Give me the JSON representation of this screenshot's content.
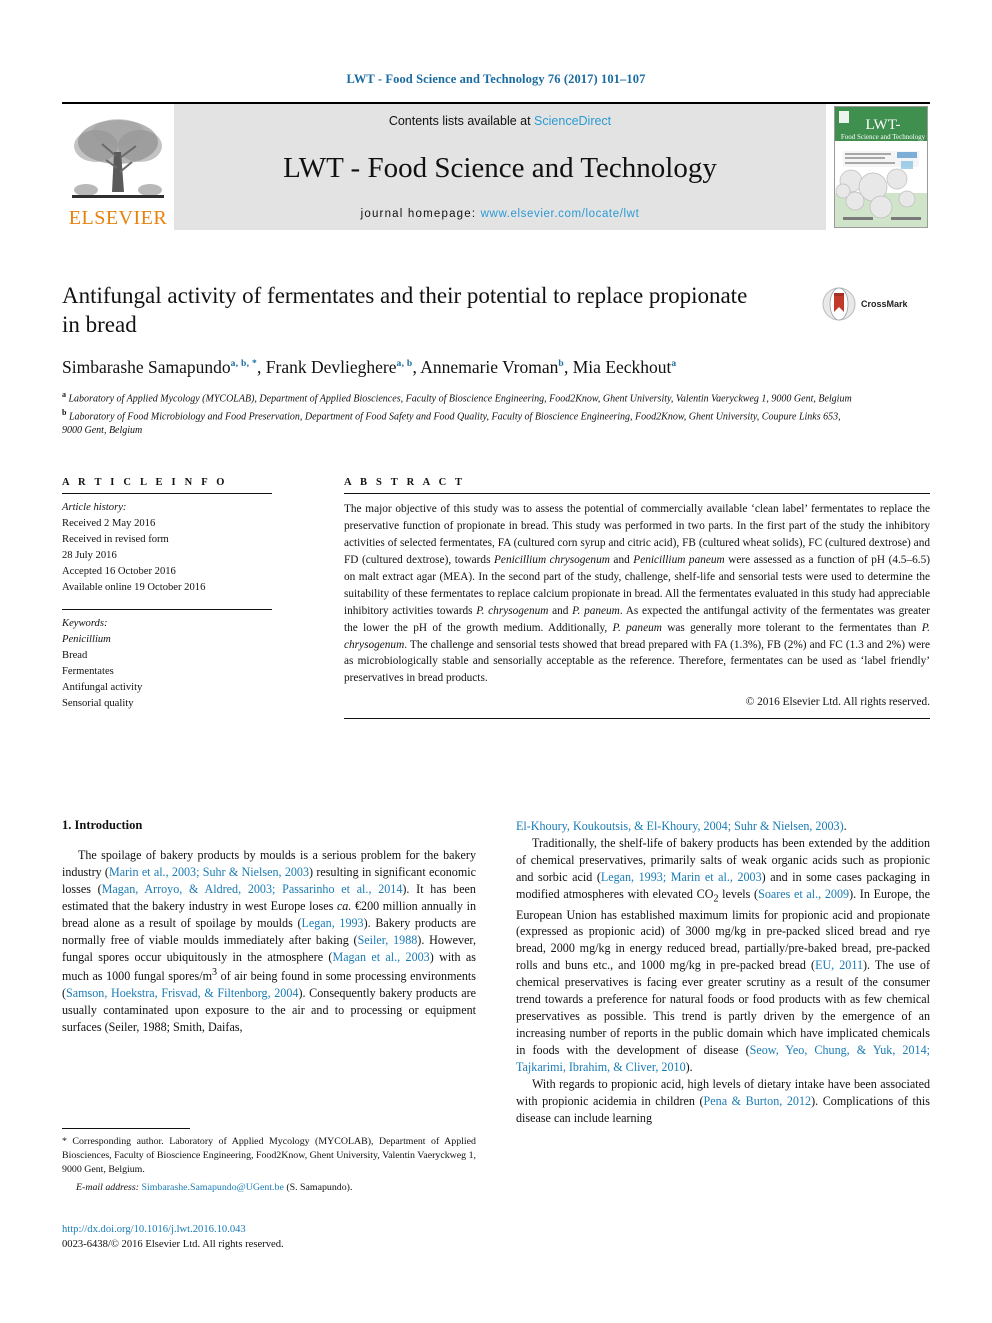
{
  "running_head": "LWT - Food Science and Technology 76 (2017) 101–107",
  "masthead": {
    "contents_prefix": "Contents lists available at ",
    "sciencedirect": "ScienceDirect",
    "journal_title": "LWT - Food Science and Technology",
    "homepage_prefix": "journal homepage: ",
    "homepage_url": "www.elsevier.com/locate/lwt",
    "publisher": "ELSEVIER",
    "cover": {
      "title_line1": "LWT-",
      "title_line2": "Food Science and Technology"
    },
    "link_color": "#2b9bd4",
    "band_color": "#e3e3e3",
    "publisher_color": "#E8820C"
  },
  "article": {
    "title": "Antifungal activity of fermentates and their potential to replace propionate in bread",
    "crossmark_label": "CrossMark",
    "authors": [
      {
        "name": "Simbarashe Samapundo",
        "marks": "a, b, *",
        "sep": ", "
      },
      {
        "name": "Frank Devlieghere",
        "marks": "a, b",
        "sep": ", "
      },
      {
        "name": "Annemarie Vroman",
        "marks": "b",
        "sep": ", "
      },
      {
        "name": "Mia Eeckhout",
        "marks": "a",
        "sep": ""
      }
    ],
    "affiliations": [
      {
        "mark": "a",
        "text": "Laboratory of Applied Mycology (MYCOLAB), Department of Applied Biosciences, Faculty of Bioscience Engineering, Food2Know, Ghent University, Valentin Vaeryckweg 1, 9000 Gent, Belgium"
      },
      {
        "mark": "b",
        "text": "Laboratory of Food Microbiology and Food Preservation, Department of Food Safety and Food Quality, Faculty of Bioscience Engineering, Food2Know, Ghent University, Coupure Links 653, 9000 Gent, Belgium"
      }
    ]
  },
  "info_panel": {
    "heading": "A R T I C L E  I N F O",
    "history_label": "Article history:",
    "history": [
      "Received 2 May 2016",
      "Received in revised form",
      "28 July 2016",
      "Accepted 16 October 2016",
      "Available online 19 October 2016"
    ],
    "keywords_label": "Keywords:",
    "keywords": [
      "Penicillium",
      "Bread",
      "Fermentates",
      "Antifungal activity",
      "Sensorial quality"
    ]
  },
  "abstract": {
    "heading": "A B S T R A C T",
    "text": "The major objective of this study was to assess the potential of commercially available ‘clean label’ fermentates to replace the preservative function of propionate in bread. This study was performed in two parts. In the first part of the study the inhibitory activities of selected fermentates, FA (cultured corn syrup and citric acid), FB (cultured wheat solids), FC (cultured dextrose) and FD (cultured dextrose), towards Penicillium chrysogenum and Penicillium paneum were assessed as a function of pH (4.5–6.5) on malt extract agar (MEA). In the second part of the study, challenge, shelf-life and sensorial tests were used to determine the suitability of these fermentates to replace calcium propionate in bread. All the fermentates evaluated in this study had appreciable inhibitory activities towards P. chrysogenum and P. paneum. As expected the antifungal activity of the fermentates was greater the lower the pH of the growth medium. Additionally, P. paneum was generally more tolerant to the fermentates than P. chrysogenum. The challenge and sensorial tests showed that bread prepared with FA (1.3%), FB (2%) and FC (1.3 and 2%) were as microbiologically stable and sensorially acceptable as the reference. Therefore, fermentates can be used as ‘label friendly’ preservatives in bread products.",
    "copyright": "© 2016 Elsevier Ltd. All rights reserved."
  },
  "introduction": {
    "heading": "1. Introduction",
    "left_paragraphs": [
      "The spoilage of bakery products by moulds is a serious problem for the bakery industry (Marin et al., 2003; Suhr & Nielsen, 2003) resulting in significant economic losses (Magan, Arroyo, & Aldred, 2003; Passarinho et al., 2014). It has been estimated that the bakery industry in west Europe loses ca. €200 million annually in bread alone as a result of spoilage by moulds (Legan, 1993). Bakery products are normally free of viable moulds immediately after baking (Seiler, 1988). However, fungal spores occur ubiquitously in the atmosphere (Magan et al., 2003) with as much as 1000 fungal spores/m3 of air being found in some processing environments (Samson, Hoekstra, Frisvad, & Filtenborg, 2004). Consequently bakery products are usually contaminated upon exposure to the air and to processing or equipment surfaces (Seiler, 1988; Smith, Daifas,"
    ],
    "right_paragraphs": [
      "El-Khoury, Koukoutsis, & El-Khoury, 2004; Suhr & Nielsen, 2003).",
      "Traditionally, the shelf-life of bakery products has been extended by the addition of chemical preservatives, primarily salts of weak organic acids such as propionic and sorbic acid (Legan, 1993; Marin et al., 2003) and in some cases packaging in modified atmospheres with elevated CO2 levels (Soares et al., 2009). In Europe, the European Union has established maximum limits for propionic acid and propionate (expressed as propionic acid) of 3000 mg/kg in pre-packed sliced bread and rye bread, 2000 mg/kg in energy reduced bread, partially/pre-baked bread, pre-packed rolls and buns etc., and 1000 mg/kg in pre-packed bread (EU, 2011). The use of chemical preservatives is facing ever greater scrutiny as a result of the consumer trend towards a preference for natural foods or food products with as few chemical preservatives as possible. This trend is partly driven by the emergence of an increasing number of reports in the public domain which have implicated chemicals in foods with the development of disease (Seow, Yeo, Chung, & Yuk, 2014; Tajkarimi, Ibrahim, & Cliver, 2010).",
      "With regards to propionic acid, high levels of dietary intake have been associated with propionic acidemia in children (Pena & Burton, 2012). Complications of this disease can include learning"
    ]
  },
  "footnote": {
    "corresponding": "* Corresponding author. Laboratory of Applied Mycology (MYCOLAB), Department of Applied Biosciences, Faculty of Bioscience Engineering, Food2Know, Ghent University, Valentin Vaeryckweg 1, 9000 Gent, Belgium.",
    "email_label": "E-mail address:",
    "email": "Simbarashe.Samapundo@UGent.be",
    "email_suffix": "(S. Samapundo)."
  },
  "footer": {
    "doi": "http://dx.doi.org/10.1016/j.lwt.2016.10.043",
    "issn_copyright": "0023-6438/© 2016 Elsevier Ltd. All rights reserved."
  },
  "colors": {
    "link": "#1a7bb5",
    "running_head": "#1a6ba0",
    "elsevier_orange": "#E8820C"
  }
}
